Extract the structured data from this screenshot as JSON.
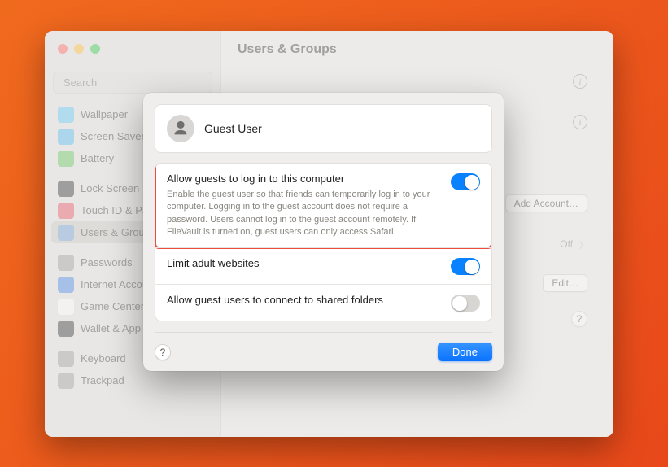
{
  "window": {
    "title": "Users & Groups"
  },
  "search": {
    "placeholder": "Search"
  },
  "sidebar": {
    "items": [
      {
        "label": "Wallpaper",
        "icon_bg": "#59c8f4"
      },
      {
        "label": "Screen Saver",
        "icon_bg": "#4cb8ef"
      },
      {
        "label": "Battery",
        "icon_bg": "#63c657"
      },
      {
        "label": "Lock Screen",
        "icon_bg": "#2e2e30"
      },
      {
        "label": "Touch ID & Password",
        "icon_bg": "#e84f5e"
      },
      {
        "label": "Users & Groups",
        "icon_bg": "#6f9ed6",
        "active": true
      },
      {
        "label": "Passwords",
        "icon_bg": "#9d9c99"
      },
      {
        "label": "Internet Accounts",
        "icon_bg": "#3f82e6"
      },
      {
        "label": "Game Center",
        "icon_bg": "#ffffff"
      },
      {
        "label": "Wallet & Apple Pay",
        "icon_bg": "#2e2e30"
      },
      {
        "label": "Keyboard",
        "icon_bg": "#9d9c99"
      },
      {
        "label": "Trackpad",
        "icon_bg": "#9d9c99"
      }
    ],
    "separators_after": [
      2,
      5,
      9
    ]
  },
  "bg_content": {
    "add_account_label": "Add Account…",
    "off_label": "Off",
    "edit_label": "Edit…"
  },
  "sheet": {
    "user_name": "Guest User",
    "settings": [
      {
        "title": "Allow guests to log in to this computer",
        "desc": "Enable the guest user so that friends can temporarily log in to your computer. Logging in to the guest account does not require a password. Users cannot log in to the guest account remotely. If FileVault is turned on, guest users can only access Safari.",
        "on": true,
        "highlighted": true
      },
      {
        "title": "Limit adult websites",
        "on": true
      },
      {
        "title": "Allow guest users to connect to shared folders",
        "on": false
      }
    ],
    "help_label": "?",
    "done_label": "Done"
  },
  "outer_help_label": "?"
}
